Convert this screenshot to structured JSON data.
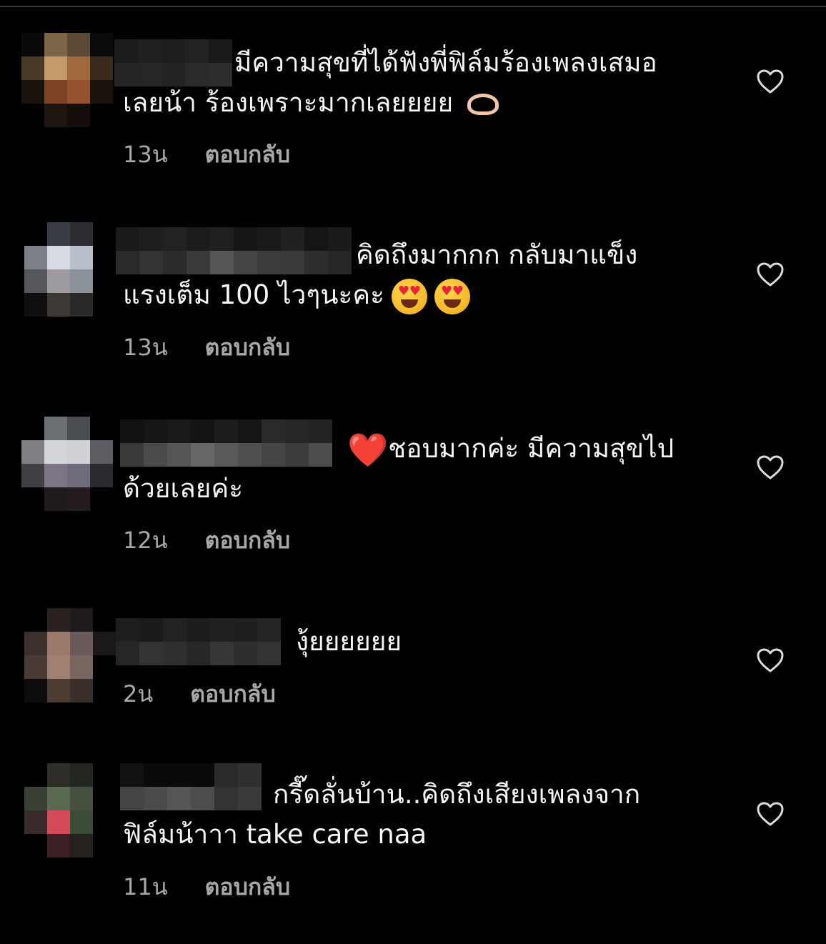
{
  "colors": {
    "background": "#000000",
    "text": "#f5f5f5",
    "meta": "#a8a8a8",
    "heart_outline": "#dcdcdc"
  },
  "comments": [
    {
      "line1": "มีความสุขที่ได้ฟังพี่ฟิล์มร้องเพลงเสมอ",
      "line2": "เลยน้า ร้องเพราะมากเลยยยย",
      "emoji_after": "heart-hands-emoji",
      "time": "13น",
      "reply": "ตอบกลับ"
    },
    {
      "line1": "คิดถึงมากกก กลับมาแข็ง",
      "line2": "แรงเต็ม 100 ไวๆนะคะ",
      "emoji_after": "heart-eyes-emoji x2",
      "time": "13น",
      "reply": "ตอบกลับ"
    },
    {
      "line1_emoji": "❤️",
      "line1": "ชอบมากค่ะ  มีความสุขไป",
      "line2": "ด้วยเลยค่ะ",
      "time": "12น",
      "reply": "ตอบกลับ"
    },
    {
      "line1": "งุ้ยยยยยย",
      "time": "2น",
      "reply": "ตอบกลับ"
    },
    {
      "line1": "กรี๊ดลั่นบ้าน..คิดถึงเสียงเพลงจาก",
      "line2": "ฟิล์มน้าาา take care naa",
      "time": "11น",
      "reply": "ตอบกลับ"
    }
  ],
  "icons": {
    "like": "heart-outline-icon"
  }
}
